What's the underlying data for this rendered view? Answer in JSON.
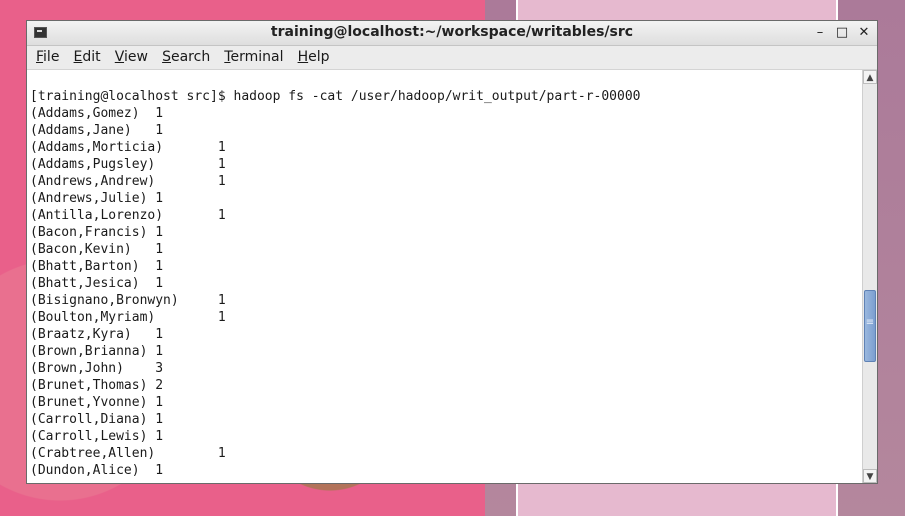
{
  "window": {
    "title": "training@localhost:~/workspace/writables/src",
    "controls": {
      "minimize": "–",
      "maximize": "□",
      "close": "✕"
    }
  },
  "menubar": {
    "items": [
      {
        "label": "File",
        "mnemonic": "F",
        "rest": "ile"
      },
      {
        "label": "Edit",
        "mnemonic": "E",
        "rest": "dit"
      },
      {
        "label": "View",
        "mnemonic": "V",
        "rest": "iew"
      },
      {
        "label": "Search",
        "mnemonic": "S",
        "rest": "earch"
      },
      {
        "label": "Terminal",
        "mnemonic": "T",
        "rest": "erminal"
      },
      {
        "label": "Help",
        "mnemonic": "H",
        "rest": "elp"
      }
    ]
  },
  "terminal": {
    "lines": [
      "[training@localhost src]$ hadoop fs -cat /user/hadoop/writ_output/part-r-00000",
      "(Addams,Gomez)  1",
      "(Addams,Jane)   1",
      "(Addams,Morticia)       1",
      "(Addams,Pugsley)        1",
      "(Andrews,Andrew)        1",
      "(Andrews,Julie) 1",
      "(Antilla,Lorenzo)       1",
      "(Bacon,Francis) 1",
      "(Bacon,Kevin)   1",
      "(Bhatt,Barton)  1",
      "(Bhatt,Jesica)  1",
      "(Bisignano,Bronwyn)     1",
      "(Boulton,Myriam)        1",
      "(Braatz,Kyra)   1",
      "(Brown,Brianna) 1",
      "(Brown,John)    3",
      "(Brunet,Thomas) 2",
      "(Brunet,Yvonne) 1",
      "(Carroll,Diana) 1",
      "(Carroll,Lewis) 1",
      "(Crabtree,Allen)        1",
      "(Dundon,Alice)  1"
    ]
  },
  "scrollbar": {
    "up_arrow": "▲",
    "down_arrow": "▼"
  }
}
